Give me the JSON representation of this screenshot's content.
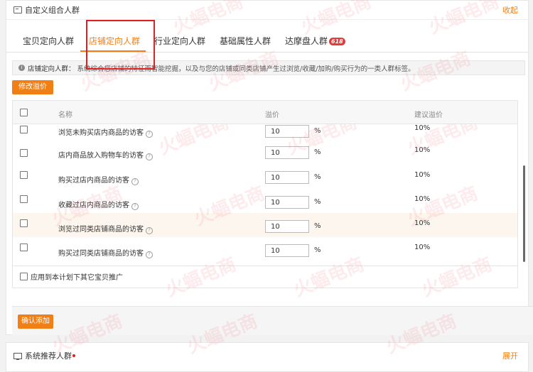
{
  "panel": {
    "title": "自定义组合人群",
    "collapse_label": "收起"
  },
  "tabs": [
    {
      "label": "宝贝定向人群"
    },
    {
      "label": "店铺定向人群"
    },
    {
      "label": "行业定向人群"
    },
    {
      "label": "基础属性人群"
    },
    {
      "label": "达摩盘人群",
      "badge": "618"
    }
  ],
  "tip": {
    "title": "店铺定向人群：",
    "text": "系统综合您店铺的特征而智能挖掘，以及与您的店铺或同类店铺产生过浏览/收藏/加购/购买行为的一类人群标签。"
  },
  "modify_bid_label": "修改溢价",
  "table": {
    "headers": {
      "name": "名称",
      "bid": "溢价",
      "suggest": "建议溢价"
    },
    "rows": [
      {
        "name": "浏览未购买店内商品的访客",
        "bid": "10",
        "unit": "%",
        "suggest": "10%"
      },
      {
        "name": "店内商品放入购物车的访客",
        "bid": "10",
        "unit": "%",
        "suggest": "10%"
      },
      {
        "name": "购买过店内商品的访客",
        "bid": "10",
        "unit": "%",
        "suggest": "10%"
      },
      {
        "name": "收藏过店内商品的访客",
        "bid": "10",
        "unit": "%",
        "suggest": "10%"
      },
      {
        "name": "浏览过同类店铺商品的访客",
        "bid": "10",
        "unit": "%",
        "suggest": "10%"
      },
      {
        "name": "购买过同类店铺商品的访客",
        "bid": "10",
        "unit": "%",
        "suggest": "10%"
      }
    ]
  },
  "apply_label": "应用到本计划下其它宝贝推广",
  "confirm_label": "确认添加",
  "panel2": {
    "title": "系统推荐人群",
    "expand_label": "展开"
  },
  "watermark": {
    "text": "火蝠电商"
  },
  "colors": {
    "accent": "#f07f16",
    "highlight": "#e02020",
    "row_highlight": "#fdf6ee"
  },
  "icons": [
    "window-icon",
    "info-icon",
    "help-icon",
    "monitor-icon"
  ]
}
